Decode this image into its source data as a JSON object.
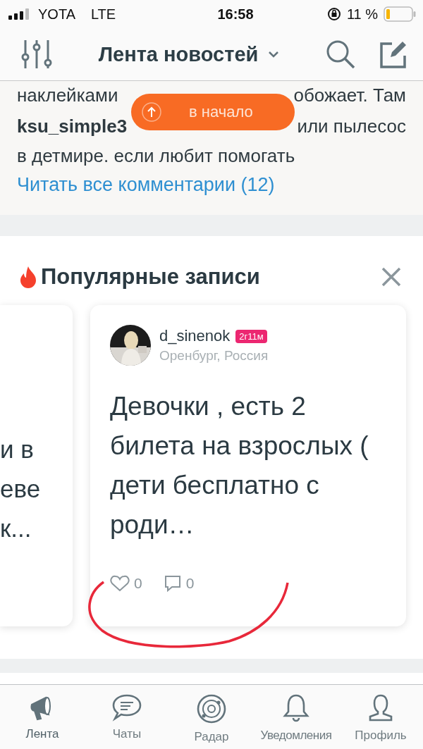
{
  "status_bar": {
    "carrier": "YOTA",
    "network": "LTE",
    "time": "16:58",
    "battery": "11 %"
  },
  "header": {
    "title": "Лента новостей"
  },
  "comments": {
    "line_1_left": "наклейками",
    "line_1_right": "обожает. Там",
    "author": "ksu_simple3",
    "line_2_right": "или пылесос",
    "line_3": "в детмире. если любит помогать",
    "link": "Читать все комментарии (12)"
  },
  "scroll_top_button": {
    "label": "в начало"
  },
  "popular": {
    "title": "Популярные записи",
    "partial_card": {
      "lines": [
        "и в",
        "еве",
        "к..."
      ]
    },
    "card": {
      "author": "d_sinenok",
      "age_badge": "2г11м",
      "location": "Оренбург, Россия",
      "text": "Девочки , есть 2 билета на взрослых ( дети бесплатно с роди…",
      "likes": "0",
      "comments": "0"
    }
  },
  "tab_bar": [
    {
      "label": "Лента",
      "selected": true
    },
    {
      "label": "Чаты",
      "selected": false
    },
    {
      "label": "Радар",
      "selected": false
    },
    {
      "label": "Уведомления",
      "selected": false
    },
    {
      "label": "Профиль",
      "selected": false
    }
  ]
}
